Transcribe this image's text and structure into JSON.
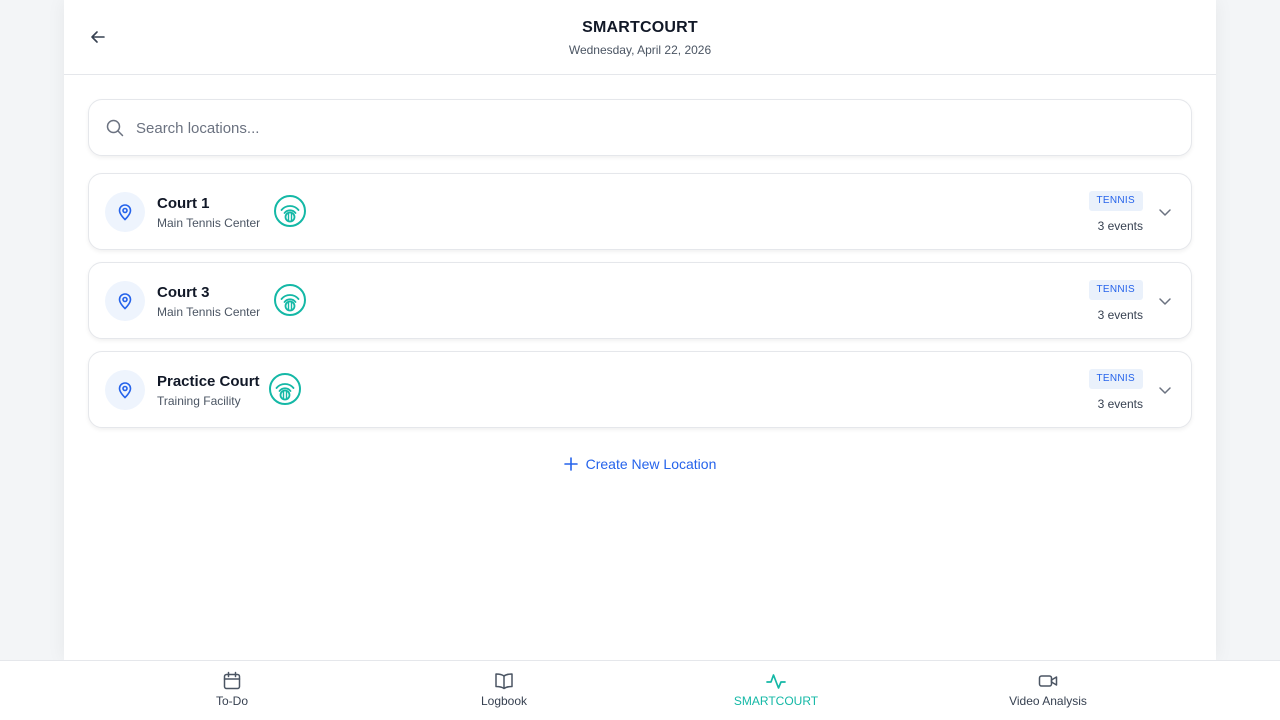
{
  "header": {
    "title": "SMARTCOURT",
    "date": "Wednesday, April 22, 2026"
  },
  "search": {
    "placeholder": "Search locations...",
    "value": ""
  },
  "locations": [
    {
      "name": "Court 1",
      "facility": "Main Tennis Center",
      "sport": "TENNIS",
      "events": "3 events"
    },
    {
      "name": "Court 3",
      "facility": "Main Tennis Center",
      "sport": "TENNIS",
      "events": "3 events"
    },
    {
      "name": "Practice Court",
      "facility": "Training Facility",
      "sport": "TENNIS",
      "events": "3 events"
    }
  ],
  "create_label": "Create New Location",
  "nav": {
    "items": [
      {
        "label": "To-Do",
        "icon": "calendar-icon"
      },
      {
        "label": "Logbook",
        "icon": "book-open-icon"
      },
      {
        "label": "SMARTCOURT",
        "icon": "activity-icon",
        "active": true
      },
      {
        "label": "Video Analysis",
        "icon": "video-camera-icon"
      }
    ]
  },
  "colors": {
    "accent_blue": "#2563eb",
    "accent_teal": "#14b8a6",
    "badge_bg": "#eaf1fb"
  }
}
